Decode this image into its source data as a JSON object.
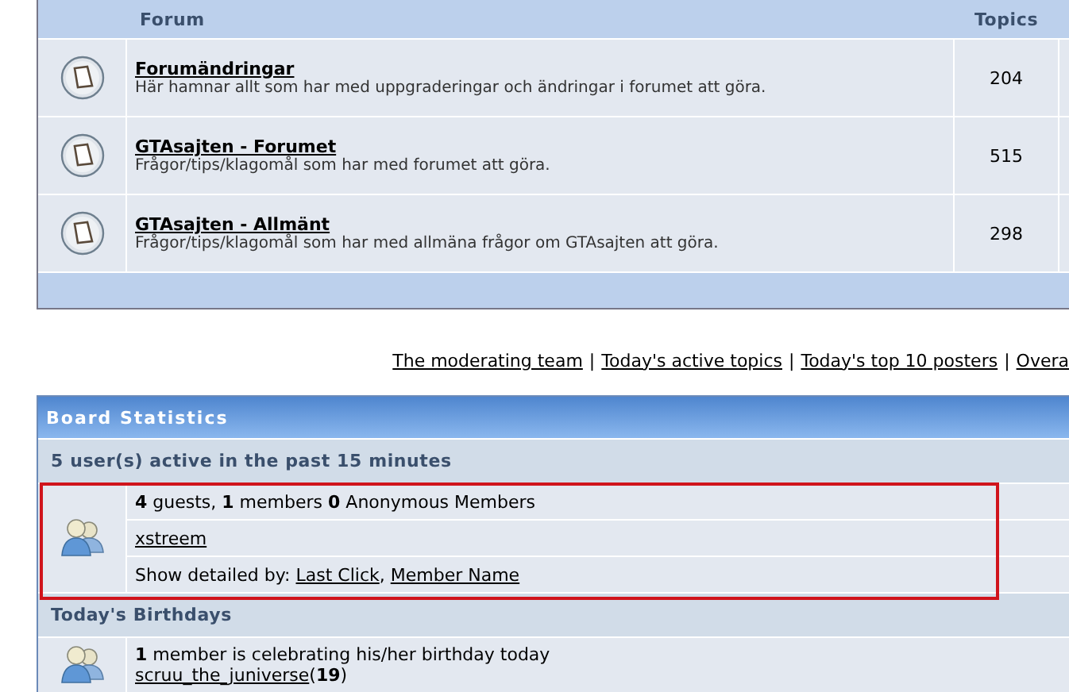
{
  "forum_table": {
    "columns": [
      "Forum",
      "Topics"
    ],
    "rows": [
      {
        "title": "Forumändringar",
        "description": "Här hamnar allt som har med uppgraderingar och ändringar i forumet att göra.",
        "topics": "204"
      },
      {
        "title": "GTAsajten - Forumet",
        "description": "Frågor/tips/klagomål som har med forumet att göra.",
        "topics": "515"
      },
      {
        "title": "GTAsajten - Allmänt",
        "description": "Frågor/tips/klagomål som har med allmäna frågor om GTAsajten att göra.",
        "topics": "298"
      }
    ]
  },
  "links": {
    "items": [
      "The moderating team",
      "Today's active topics",
      "Today's top 10 posters",
      "Overa"
    ],
    "separator": "|"
  },
  "board_statistics": {
    "title": "Board Statistics",
    "active_users": {
      "heading": "5 user(s) active in the past 15 minutes",
      "summary": "**4** guests, **1** members **0** Anonymous Members",
      "members": [
        "xstreem"
      ],
      "detail_label": "Show detailed by:",
      "detail_links": [
        "Last Click",
        "Member Name"
      ],
      "detail_separator": ","
    },
    "birthdays": {
      "heading": "Today's Birthdays",
      "summary": "**1** member is celebrating his/her birthday today",
      "member": "scruu_the_juniverse",
      "age": "(**19**)"
    }
  }
}
